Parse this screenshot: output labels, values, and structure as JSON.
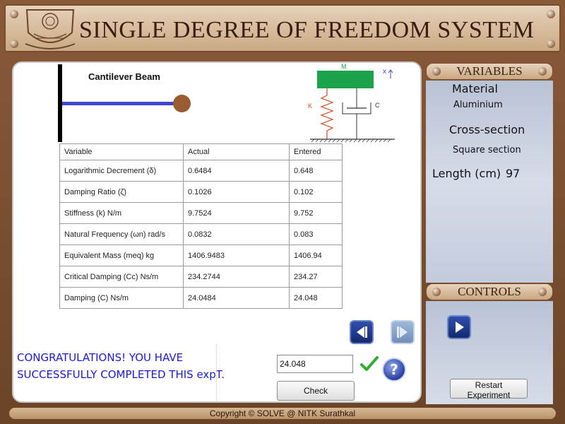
{
  "app": {
    "title": "SINGLE DEGREE OF FREEDOM SYSTEM"
  },
  "diagram": {
    "beam_label": "Cantilever Beam",
    "mass_label": "M",
    "spring_label": "K",
    "damper_label": "C",
    "axis_label": "x"
  },
  "table": {
    "headers": [
      "Variable",
      "Actual",
      "Entered"
    ],
    "rows": [
      {
        "variable": "Logarithmic Decrement (δ)",
        "actual": "0.6484",
        "entered": "0.648"
      },
      {
        "variable": "Damping Ratio (ζ)",
        "actual": "0.1026",
        "entered": "0.102"
      },
      {
        "variable": "Stiffness (k) N/m",
        "actual": "9.7524",
        "entered": "9.752"
      },
      {
        "variable": "Natural Frequency (ωn) rad/s",
        "actual": "0.0832",
        "entered": "0.083"
      },
      {
        "variable": "Equivalent Mass (meq) kg",
        "actual": "1406.9483",
        "entered": "1406.94"
      },
      {
        "variable": "Critical Damping (Cc) Ns/m",
        "actual": "234.2744",
        "entered": "234.27"
      },
      {
        "variable": "Damping (C) Ns/m",
        "actual": "24.0484",
        "entered": "24.048"
      }
    ]
  },
  "message": {
    "line1": "CONGRATULATIONS! YOU HAVE",
    "line2": "SUCCESSFULLY COMPLETED THIS expT."
  },
  "answer": {
    "value": "24.048",
    "check_label": "Check"
  },
  "variables": {
    "heading": "VARIABLES",
    "material_label": "Material",
    "material_value": "Aluminium",
    "cross_section_label": "Cross-section",
    "cross_section_value": "Square section",
    "length_label": "Length (cm)",
    "length_value": "97"
  },
  "controls": {
    "heading": "CONTROLS",
    "restart_label": "Restart Experiment"
  },
  "footer": {
    "text": "Copyright © SOLVE @ NITK Surathkal"
  },
  "colors": {
    "beam": "#3f48cc",
    "mass": "#9a5b32",
    "block": "#1aa34a",
    "spring": "#d44a1a",
    "message": "#1a1ad6",
    "nav_active": "#1f3a8c",
    "nav_disabled": "#7f9fc4"
  },
  "icons": [
    "prev-icon",
    "next-icon",
    "play-icon",
    "checkmark-icon",
    "help-icon",
    "logo-emblem"
  ]
}
